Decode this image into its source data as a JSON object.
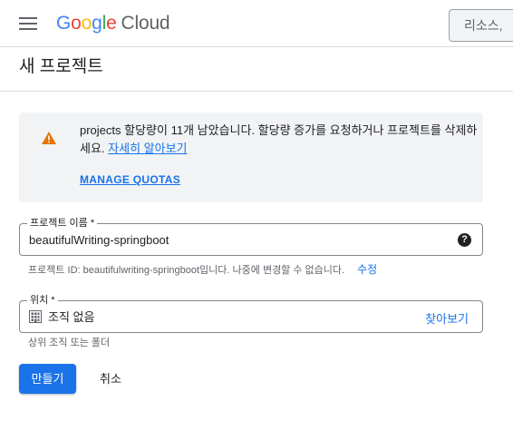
{
  "header": {
    "logo": {
      "g1": "G",
      "o1": "o",
      "o2": "o",
      "g2": "g",
      "l": "l",
      "e": "e",
      "cloud": "Cloud"
    },
    "resource_search": "리소스, ",
    "menu_icon": "hamburger-menu-icon"
  },
  "page": {
    "title": "새 프로젝트"
  },
  "alert": {
    "icon": "warning-icon",
    "message": "projects 할당량이 11개 남았습니다. 할당량 증가를 요청하거나 프로젝트를 삭제하세요. ",
    "link": "자세히 알아보기",
    "manage": "MANAGE QUOTAS"
  },
  "project_name": {
    "label": "프로젝트 이름 *",
    "value": "beautifulWriting-springboot",
    "help_icon": "help-icon"
  },
  "project_id": {
    "hint": "프로젝트 ID: beautifulwriting-springboot입니다. 나중에 변경할 수 없습니다.",
    "edit": "수정"
  },
  "location": {
    "label": "위치 *",
    "value": "조직 없음",
    "icon": "building-icon",
    "browse": "찾아보기",
    "hint": "상위 조직 또는 폴더"
  },
  "actions": {
    "create": "만들기",
    "cancel": "취소"
  },
  "colors": {
    "primary": "#1a73e8",
    "warning": "#e37400",
    "alert_bg": "#f1f3f4"
  }
}
